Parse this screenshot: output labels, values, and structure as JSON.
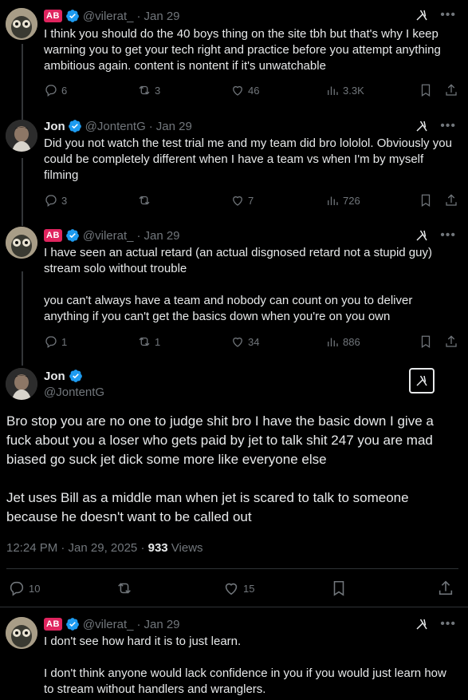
{
  "tweets": [
    {
      "badge": "AB",
      "handle": "@vilerat_",
      "sep": "·",
      "date": "Jan 29",
      "text": "I think you should do the 40 boys thing on the site tbh but that's why I keep warning you to get your tech right and practice before you attempt anything ambitious again. content is nontent if it's unwatchable",
      "replies": "6",
      "reposts": "3",
      "likes": "46",
      "views": "3.3K"
    },
    {
      "name": "Jon",
      "handle": "@JontentG",
      "sep": "·",
      "date": "Jan 29",
      "text": "Did you not watch the test trial me and my team did bro lololol. Obviously you could be completely different when I have a team vs when I'm by myself filming",
      "replies": "3",
      "reposts": "",
      "likes": "7",
      "views": "726"
    },
    {
      "badge": "AB",
      "handle": "@vilerat_",
      "sep": "·",
      "date": "Jan 29",
      "text": "I have seen an actual retard (an actual disgnosed retard not a stupid guy) stream solo without trouble\n\nyou can't always have a team and nobody can count on you to deliver anything if you can't get the basics down when you're on you own",
      "replies": "1",
      "reposts": "1",
      "likes": "34",
      "views": "886"
    }
  ],
  "focal": {
    "name": "Jon",
    "handle": "@JontentG",
    "text": "Bro stop you are no one to judge shit bro I have the basic down I give a fuck about you a loser who gets paid by jet to talk shit 247 you are mad biased go suck jet dick some more like everyone else\n\nJet uses Bill as a middle man when jet is scared to talk to someone because he doesn't want to be called out",
    "time": "12:24 PM · Jan 29, 2025 · ",
    "views_count": "933",
    "views_label": " Views",
    "replies": "10",
    "likes": "15"
  },
  "reply": {
    "badge": "AB",
    "handle": "@vilerat_",
    "sep": "·",
    "date": "Jan 29",
    "text": "I don't see how hard it is to just learn.\n\nI don't think anyone would lack confidence in you if you would just learn how to stream without handlers and wranglers."
  },
  "colors": {
    "verified": "#1d9bf0",
    "badge": "#e0245e",
    "muted": "#71767b"
  }
}
